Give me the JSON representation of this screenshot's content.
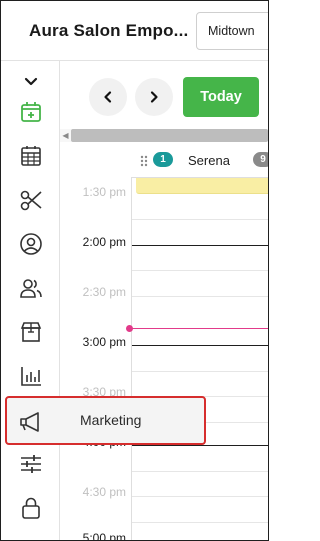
{
  "app": {
    "salon_name": "Aura Salon Empo...",
    "location": "Midtown"
  },
  "sidebar": {
    "items": [
      {
        "icon": "chevron-down-icon"
      },
      {
        "icon": "calendar-add-icon",
        "active": true
      },
      {
        "icon": "calendar-grid-icon"
      },
      {
        "icon": "scissors-icon"
      },
      {
        "icon": "user-circle-icon"
      },
      {
        "icon": "users-icon"
      },
      {
        "icon": "store-icon"
      },
      {
        "icon": "bar-chart-icon"
      },
      {
        "icon": "megaphone-icon"
      },
      {
        "icon": "sliders-icon"
      },
      {
        "icon": "lock-icon"
      }
    ],
    "tooltip": "Marketing"
  },
  "toolbar": {
    "prev_icon": "chevron-left-icon",
    "next_icon": "chevron-right-icon",
    "today_label": "Today"
  },
  "calendar": {
    "staff": {
      "name": "Serena",
      "badge": "1",
      "next_badge": "9"
    },
    "time_labels": [
      {
        "label": "1:30 pm",
        "faded": true
      },
      {
        "label": "2:00 pm",
        "faded": false
      },
      {
        "label": "2:30 pm",
        "faded": true
      },
      {
        "label": "3:00 pm",
        "faded": false
      },
      {
        "label": "3:30 pm",
        "faded": true
      },
      {
        "label": "4:00 pm",
        "faded": false
      },
      {
        "label": "4:30 pm",
        "faded": true
      },
      {
        "label": "5:00 pm",
        "faded": false
      }
    ]
  },
  "colors": {
    "accent_green": "#45b549",
    "current_time": "#e23a8a",
    "appointment": "#f9eea4",
    "tooltip_border": "#d62d2d",
    "staff_badge": "#1a9a9a"
  }
}
